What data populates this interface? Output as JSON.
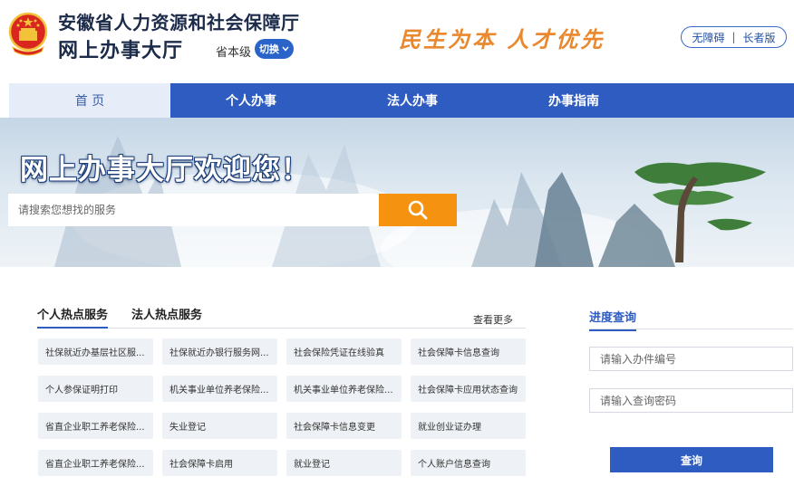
{
  "header": {
    "org_name": "安徽省人力资源和社会保障厅",
    "hall_name": "网上办事大厅",
    "level_label": "省本级",
    "switch_label": "切换",
    "slogan": "民生为本  人才优先",
    "accessibility_label": "无障碍",
    "elder_label": "长者版"
  },
  "nav": {
    "items": [
      {
        "label": "首 页",
        "active": true
      },
      {
        "label": "个人办事",
        "active": false
      },
      {
        "label": "法人办事",
        "active": false
      },
      {
        "label": "办事指南",
        "active": false
      }
    ]
  },
  "banner": {
    "title": "网上办事大厅欢迎您！",
    "search_placeholder": "请搜索您想找的服务",
    "search_icon": "search-icon"
  },
  "hot_services": {
    "tabs": [
      "个人热点服务",
      "法人热点服务"
    ],
    "more_label": "查看更多",
    "items": [
      "社保就近办基层社区服...",
      "社保就近办银行服务网...",
      "社会保险凭证在线验真",
      "社会保障卡信息查询",
      "个人参保证明打印",
      "机关事业单位养老保险...",
      "机关事业单位养老保险...",
      "社会保障卡应用状态查询",
      "省直企业职工养老保险...",
      "失业登记",
      "社会保障卡信息变更",
      "就业创业证办理",
      "省直企业职工养老保险...",
      "社会保障卡启用",
      "就业登记",
      "个人账户信息查询"
    ]
  },
  "progress": {
    "title": "进度查询",
    "case_no_placeholder": "请输入办件编号",
    "password_placeholder": "请输入查询密码",
    "query_label": "查询"
  },
  "colors": {
    "primary": "#2f5cc0",
    "accent": "#f5920f",
    "slogan": "#e9882e",
    "title_dark": "#1c2b4a"
  }
}
